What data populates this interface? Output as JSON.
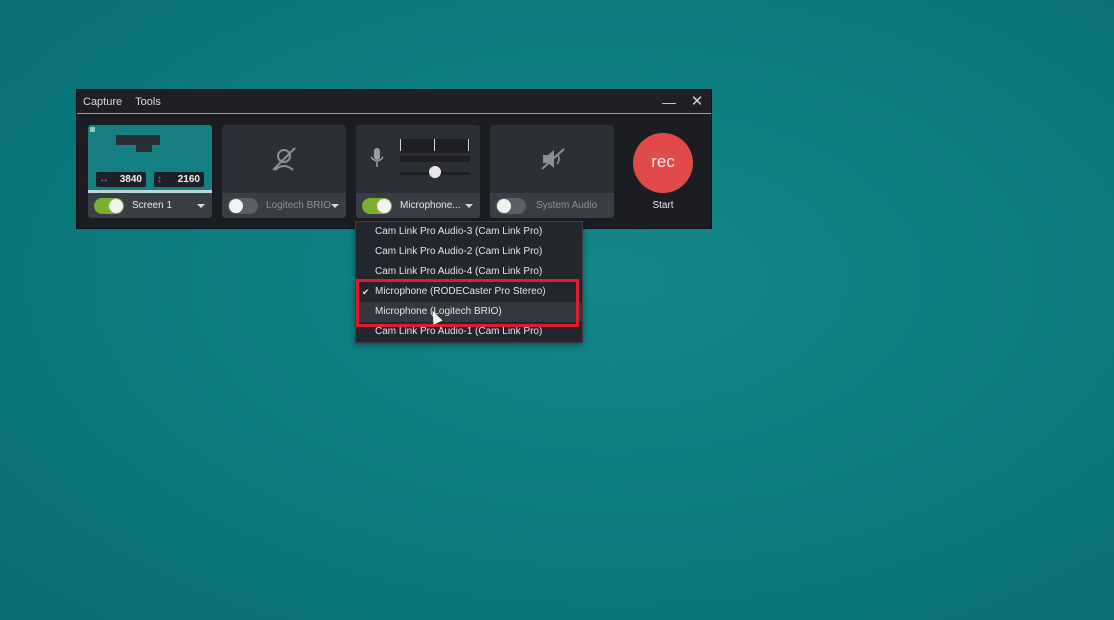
{
  "menu": {
    "capture": "Capture",
    "tools": "Tools"
  },
  "window_controls": {
    "minimize": "—",
    "close": "✕"
  },
  "screen_panel": {
    "width": "3840",
    "height": "2160",
    "width_icon": "↔",
    "height_icon": "↕",
    "label": "Screen 1",
    "toggle_on": true
  },
  "camera_panel": {
    "label": "Logitech BRIO",
    "toggle_on": false,
    "icon": "camera-off-icon"
  },
  "mic_panel": {
    "label": "Microphone...",
    "toggle_on": true,
    "icon": "microphone-icon"
  },
  "system_audio_panel": {
    "label": "System Audio",
    "toggle_on": false,
    "icon": "speaker-muted-icon"
  },
  "record": {
    "button_label": "rec",
    "start_label": "Start",
    "color": "#e04a48"
  },
  "dropdown": {
    "items": [
      {
        "label": "Cam Link Pro Audio-3 (Cam Link Pro)",
        "checked": false
      },
      {
        "label": "Cam Link Pro Audio-2 (Cam Link Pro)",
        "checked": false
      },
      {
        "label": "Cam Link Pro Audio-4 (Cam Link Pro)",
        "checked": false
      },
      {
        "label": "Microphone (RODECaster Pro Stereo)",
        "checked": true
      },
      {
        "label": "Microphone (Logitech BRIO)",
        "checked": false,
        "hovered": true
      },
      {
        "label": "Cam Link Pro Audio-1 (Cam Link Pro)",
        "checked": false
      }
    ],
    "check_glyph": "✔"
  },
  "colors": {
    "accent_green": "#7cae2f",
    "highlight_red": "#e01b2b",
    "background_teal": "#0c7a7d"
  }
}
